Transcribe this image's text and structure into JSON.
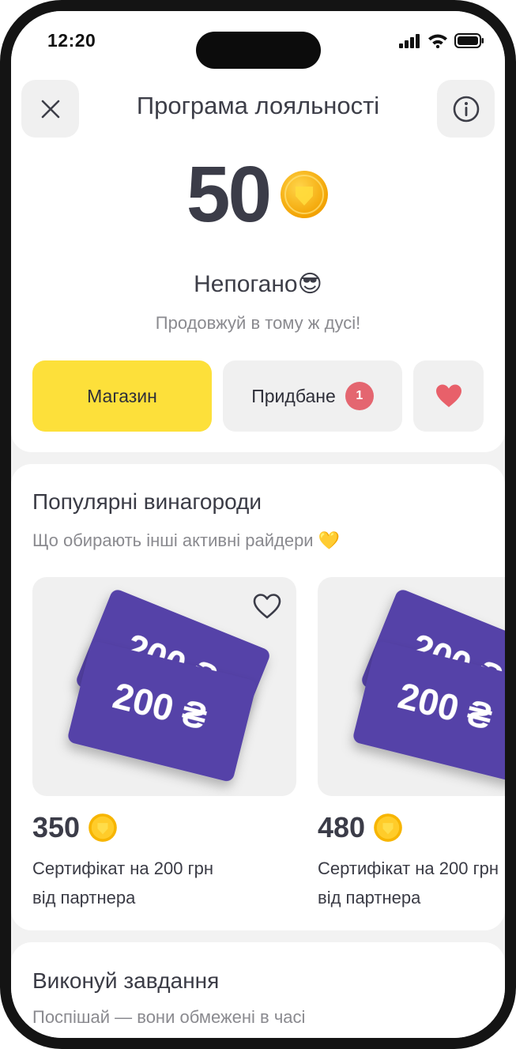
{
  "status_bar": {
    "time": "12:20"
  },
  "header": {
    "title": "Програма лояльності"
  },
  "balance": {
    "points": "50",
    "headline": "Непогано",
    "headline_emoji": "😎",
    "subline": "Продовжуй в тому ж дусі!"
  },
  "tabs": {
    "shop": "Магазин",
    "bought": "Придбане",
    "bought_badge": "1"
  },
  "popular": {
    "title": "Популярні винагороди",
    "subtitle": "Що обирають інші активні райдери 💛",
    "items": [
      {
        "card_text": "200 ₴",
        "price": "350",
        "name_line1": "Сертифікат на 200 грн",
        "name_line2": "від партнера"
      },
      {
        "card_text": "200 ₴",
        "price": "480",
        "name_line1": "Сертифікат на 200 грн",
        "name_line2": "від партнера"
      }
    ]
  },
  "tasks": {
    "title": "Виконуй завдання",
    "subtitle": "Поспішай — вони обмежені в часі"
  },
  "colors": {
    "accent_yellow": "#fde03a",
    "card_purple": "#5543a8",
    "badge_red": "#e46670",
    "heart_red": "#e8606a",
    "coin_gold": "#f7b500"
  }
}
